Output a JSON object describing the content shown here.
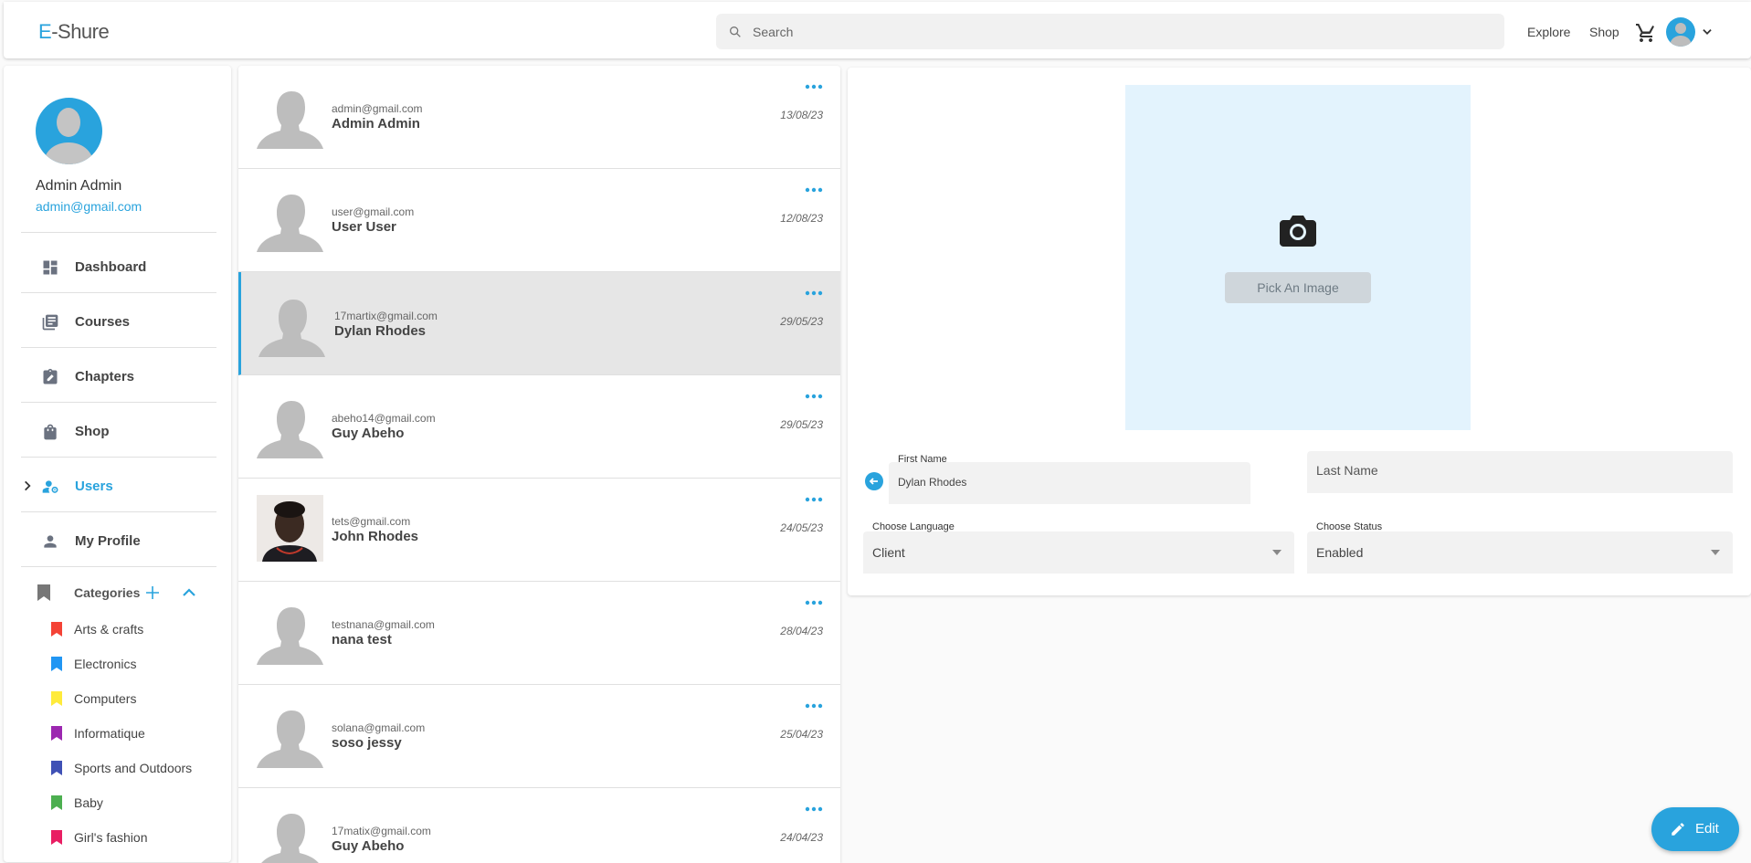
{
  "header": {
    "logo_prefix": "E",
    "logo_rest": "-Shure",
    "search_placeholder": "Search",
    "explore": "Explore",
    "shop": "Shop"
  },
  "sidebar": {
    "profile": {
      "name": "Admin Admin",
      "email": "admin@gmail.com"
    },
    "menu": [
      {
        "label": "Dashboard",
        "icon": "dashboard-icon"
      },
      {
        "label": "Courses",
        "icon": "library-books-icon"
      },
      {
        "label": "Chapters",
        "icon": "assignment-icon"
      },
      {
        "label": "Shop",
        "icon": "shopping-bag-icon"
      },
      {
        "label": "Users",
        "icon": "manage-accounts-icon",
        "active": true
      },
      {
        "label": "My Profile",
        "icon": "person-icon"
      }
    ],
    "categories_label": "Categories",
    "categories": [
      {
        "label": "Arts & crafts",
        "color": "#f44336"
      },
      {
        "label": "Electronics",
        "color": "#2196f3"
      },
      {
        "label": "Computers",
        "color": "#ffeb3b"
      },
      {
        "label": "Informatique",
        "color": "#9c27b0"
      },
      {
        "label": "Sports and Outdoors",
        "color": "#3f51b5"
      },
      {
        "label": "Baby",
        "color": "#4caf50"
      },
      {
        "label": "Girl's fashion",
        "color": "#e91e63"
      }
    ]
  },
  "users": [
    {
      "email": "admin@gmail.com",
      "name": "Admin Admin",
      "date": "13/08/23"
    },
    {
      "email": "user@gmail.com",
      "name": "User User",
      "date": "12/08/23"
    },
    {
      "email": "17martix@gmail.com",
      "name": "Dylan Rhodes",
      "date": "29/05/23",
      "selected": true
    },
    {
      "email": "abeho14@gmail.com",
      "name": "Guy Abeho",
      "date": "29/05/23"
    },
    {
      "email": "tets@gmail.com",
      "name": "John Rhodes",
      "date": "24/05/23",
      "photo": true
    },
    {
      "email": "testnana@gmail.com",
      "name": "nana test",
      "date": "28/04/23"
    },
    {
      "email": "solana@gmail.com",
      "name": "soso jessy",
      "date": "25/04/23"
    },
    {
      "email": "17matix@gmail.com",
      "name": "Guy Abeho",
      "date": "24/04/23"
    }
  ],
  "detail": {
    "pick_image": "Pick An Image",
    "first_name_label": "First Name",
    "first_name_value": "Dylan Rhodes",
    "last_name_placeholder": "Last Name",
    "language_label": "Choose Language",
    "language_value": "Client",
    "status_label": "Choose Status",
    "status_value": "Enabled"
  },
  "fab": {
    "label": "Edit"
  },
  "colors": {
    "accent": "#29a3dd",
    "image_bg": "#e3f3fd"
  }
}
